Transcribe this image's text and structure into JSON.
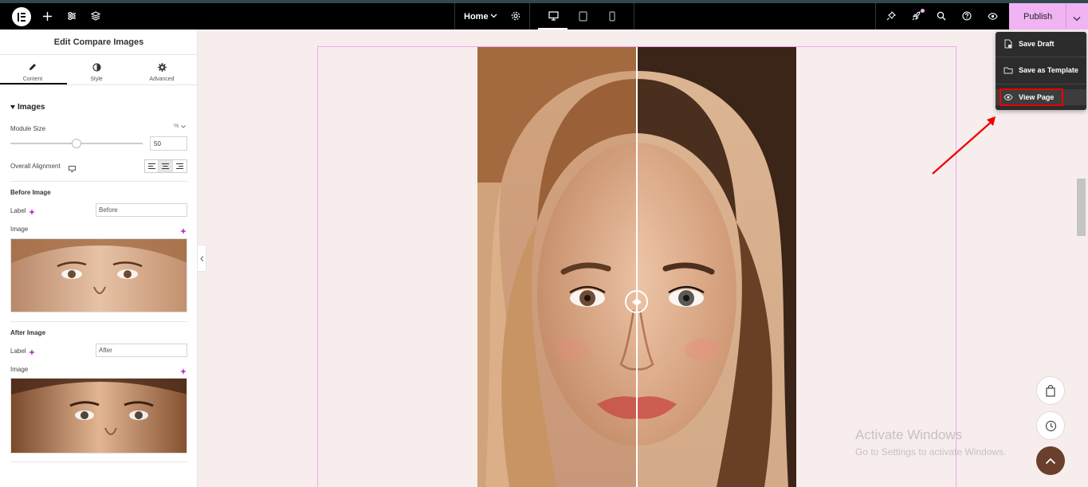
{
  "topbar": {
    "page_selector": "Home",
    "publish_label": "Publish"
  },
  "panel": {
    "title": "Edit Compare Images",
    "tabs": [
      {
        "label": "Content",
        "icon": "pencil-icon"
      },
      {
        "label": "Style",
        "icon": "contrast-icon"
      },
      {
        "label": "Advanced",
        "icon": "gear-icon"
      }
    ],
    "section_title": "Images",
    "module_size": {
      "label": "Module Size",
      "unit": "%",
      "value": "50",
      "fraction": 0.5
    },
    "overall_alignment_label": "Overall Alignment",
    "before": {
      "heading": "Before Image",
      "label_caption": "Label",
      "label_value": "Before",
      "image_caption": "Image"
    },
    "after": {
      "heading": "After Image",
      "label_caption": "Label",
      "label_value": "After",
      "image_caption": "Image"
    }
  },
  "dropdown": {
    "items": [
      {
        "label": "Save Draft",
        "icon": "file-lock-icon"
      },
      {
        "label": "Save as Template",
        "icon": "folder-icon"
      },
      {
        "label": "View Page",
        "icon": "eye-icon"
      }
    ]
  },
  "watermark": {
    "title": "Activate Windows",
    "subtitle": "Go to Settings to activate Windows."
  },
  "colors": {
    "publish_bg": "#f0b3f3",
    "canvas_bg": "#f7eded",
    "highlight": "#e00000",
    "fab_dark": "#6b3f2e"
  }
}
